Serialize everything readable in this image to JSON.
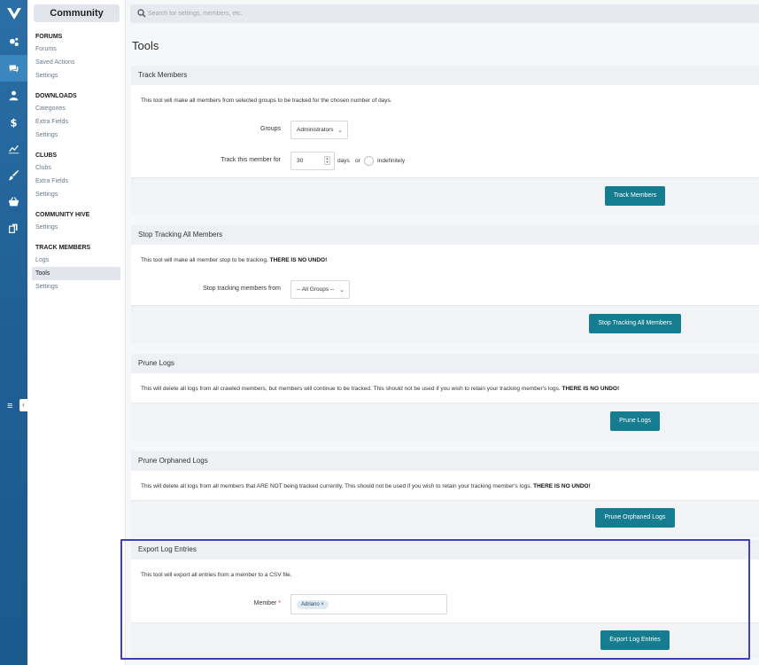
{
  "nav": {
    "header": "Community",
    "groups": [
      {
        "title": "FORUMS",
        "items": [
          "Forums",
          "Saved Actions",
          "Settings"
        ]
      },
      {
        "title": "DOWNLOADS",
        "items": [
          "Categories",
          "Extra Fields",
          "Settings"
        ]
      },
      {
        "title": "CLUBS",
        "items": [
          "Clubs",
          "Extra Fields",
          "Settings"
        ]
      },
      {
        "title": "COMMUNITY HIVE",
        "items": [
          "Settings"
        ]
      },
      {
        "title": "TRACK MEMBERS",
        "items": [
          "Logs",
          "Tools",
          "Settings"
        ]
      }
    ],
    "selected": "Tools"
  },
  "search": {
    "placeholder": "Search for settings, members, etc."
  },
  "page": {
    "title": "Tools"
  },
  "sections": {
    "track": {
      "title": "Track Members",
      "desc": "This tool will make all members from selected groups to be tracked for the chosen number of days.",
      "groups_label": "Groups",
      "groups_value": "Administrators",
      "days_label": "Track this member for",
      "days_value": "30",
      "days_suffix": "days",
      "or": "or",
      "indefinitely": "Indefinitely",
      "button": "Track Members"
    },
    "stop": {
      "title": "Stop Tracking All Members",
      "desc": "This tool will make all member stop to be tracking.",
      "warn": "THERE IS NO UNDO!",
      "from_label": "Stop tracking members from",
      "from_value": "-- All Groups --",
      "button": "Stop Tracking All Members"
    },
    "prune": {
      "title": "Prune Logs",
      "desc": "This will delete all logs from all crawled members, but members will continue to be tracked. This should not be used if you wish to retain your tracking member's logs.",
      "warn": "THERE IS NO UNDO!",
      "button": "Prune Logs"
    },
    "orphan": {
      "title": "Prune Orphaned Logs",
      "desc": "This will delete all logs from all members that ARE NOT being tracked currently. This should not be used if you wish to retain your tracking member's logs.",
      "warn": "THERE IS NO UNDO!",
      "button": "Prune Orphaned Logs"
    },
    "export": {
      "title": "Export Log Entries",
      "desc": "This tool will export all entries from a member to a CSV file.",
      "member_label": "Member",
      "required_mark": "*",
      "member_token": "Adriano ×",
      "button": "Export Log Entries"
    }
  },
  "colors": {
    "primary_button": "#167c8f",
    "rail": "#1f5f95",
    "highlight": "#3f3fbf"
  }
}
